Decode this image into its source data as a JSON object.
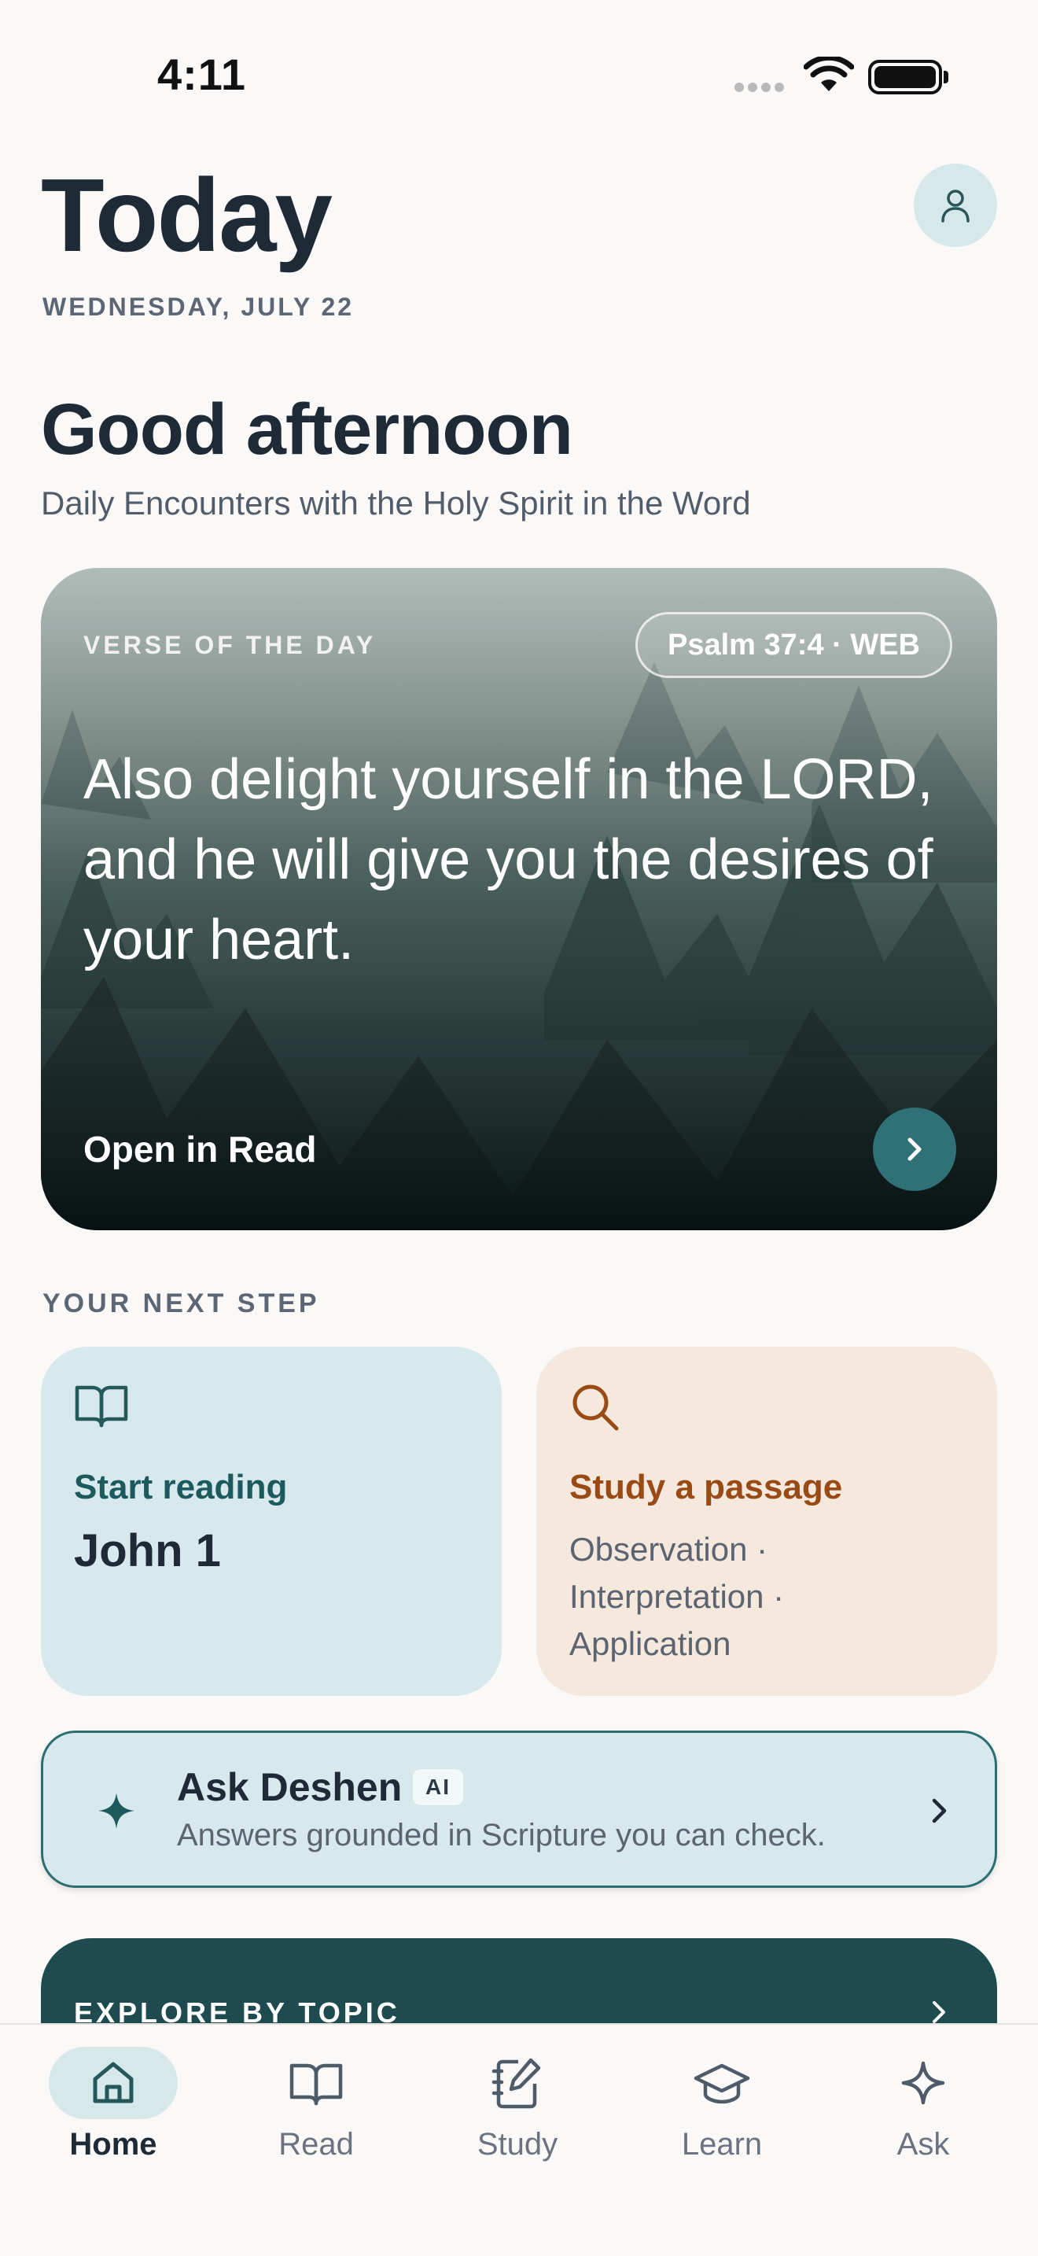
{
  "status": {
    "time": "4:11"
  },
  "header": {
    "title": "Today",
    "date": "WEDNESDAY, JULY 22",
    "greeting": "Good afternoon",
    "tagline": "Daily Encounters with the Holy Spirit in the Word"
  },
  "verse": {
    "label": "VERSE OF THE DAY",
    "reference": "Psalm 37:4 · WEB",
    "text": "Also delight yourself in the LORD, and he will give you the desires of your heart.",
    "action": "Open in Read"
  },
  "next_step": {
    "label": "YOUR NEXT STEP",
    "read": {
      "kicker": "Start reading",
      "title": "John 1",
      "icon": "book-open-icon"
    },
    "study": {
      "kicker": "Study a passage",
      "subtitle": "Observation · Interpretation · Application",
      "icon": "search-icon"
    }
  },
  "ask": {
    "title": "Ask Deshen",
    "badge": "AI",
    "subtitle": "Answers grounded in Scripture you can check.",
    "icon": "sparkle-icon"
  },
  "explore": {
    "label": "EXPLORE BY TOPIC"
  },
  "tabs": [
    {
      "label": "Home",
      "icon": "home-icon",
      "active": true
    },
    {
      "label": "Read",
      "icon": "book-open-icon",
      "active": false
    },
    {
      "label": "Study",
      "icon": "notebook-pen-icon",
      "active": false
    },
    {
      "label": "Learn",
      "icon": "graduation-cap-icon",
      "active": false
    },
    {
      "label": "Ask",
      "icon": "sparkle-icon",
      "active": false
    }
  ],
  "colors": {
    "background": "#fbf9f7",
    "accent_teal": "#2f7176",
    "card_blue": "#d7e9ec",
    "card_peach": "#f5e8dd",
    "study_accent": "#9a4a15",
    "explore_card": "#1d4b50"
  }
}
